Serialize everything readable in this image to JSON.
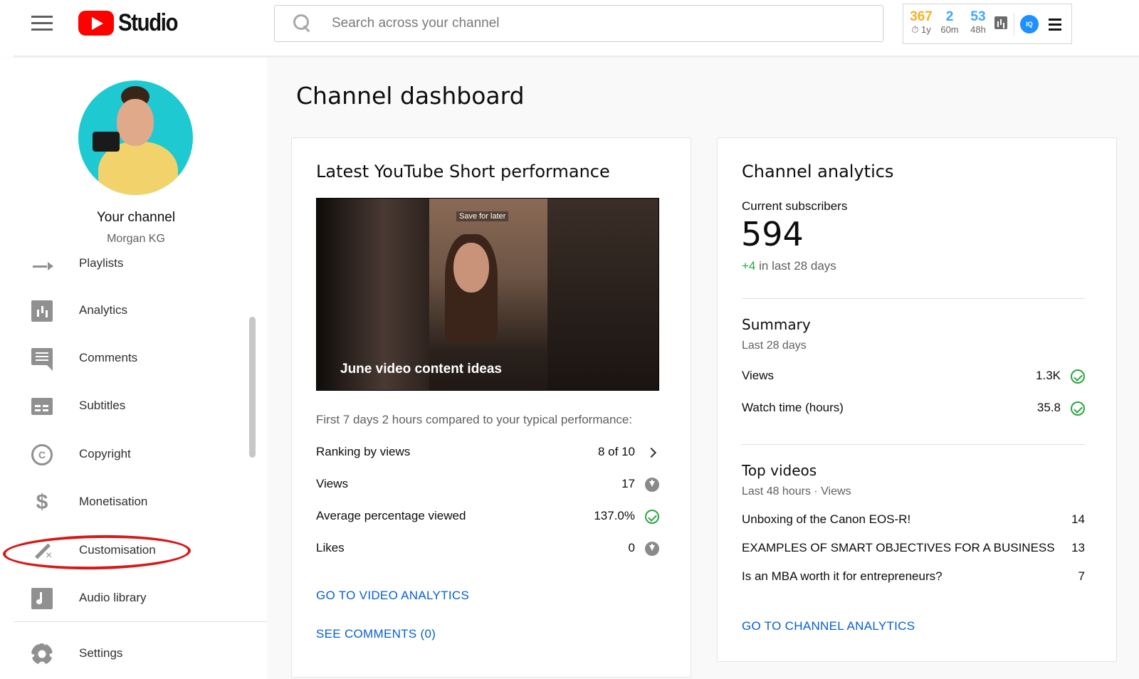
{
  "header": {
    "logo_text": "Studio",
    "search_placeholder": "Search across your channel",
    "extension": {
      "stats": [
        {
          "value": "367",
          "label": "⏱ 1y",
          "color": "#f0b429"
        },
        {
          "value": "2",
          "label": "60m",
          "color": "#3ea6ff"
        },
        {
          "value": "53",
          "label": "48h",
          "color": "#3ea6ff"
        }
      ],
      "badge": "IQ"
    }
  },
  "sidebar": {
    "channel_title": "Your channel",
    "channel_name": "Morgan KG",
    "items": [
      {
        "label": "Playlists",
        "icon": "playlists-icon"
      },
      {
        "label": "Analytics",
        "icon": "analytics-icon"
      },
      {
        "label": "Comments",
        "icon": "comments-icon"
      },
      {
        "label": "Subtitles",
        "icon": "subtitles-icon"
      },
      {
        "label": "Copyright",
        "icon": "copyright-icon"
      },
      {
        "label": "Monetisation",
        "icon": "monetisation-icon"
      },
      {
        "label": "Customisation",
        "icon": "customisation-wand-icon"
      },
      {
        "label": "Audio library",
        "icon": "audio-library-icon"
      },
      {
        "label": "Settings",
        "icon": "settings-gear-icon"
      }
    ]
  },
  "main": {
    "page_title": "Channel dashboard",
    "short_card": {
      "title": "Latest YouTube Short performance",
      "thumbnail_caption": "June video content ideas",
      "thumbnail_overlay": "Save for later",
      "comparison_text": "First 7 days 2 hours compared to your typical performance:",
      "metrics": [
        {
          "label": "Ranking by views",
          "value": "8 of 10",
          "indicator": "chevron-right-icon"
        },
        {
          "label": "Views",
          "value": "17",
          "indicator": "arrow-down-icon"
        },
        {
          "label": "Average percentage viewed",
          "value": "137.0%",
          "indicator": "check-circle-icon"
        },
        {
          "label": "Likes",
          "value": "0",
          "indicator": "arrow-down-icon"
        }
      ],
      "link_analytics": "GO TO VIDEO ANALYTICS",
      "link_comments": "SEE COMMENTS (0)"
    },
    "analytics_card": {
      "title": "Channel analytics",
      "subscribers_label": "Current subscribers",
      "subscribers_value": "594",
      "subscribers_delta": "+4",
      "subscribers_delta_suffix": " in last 28 days",
      "summary_title": "Summary",
      "summary_period": "Last 28 days",
      "summary_rows": [
        {
          "label": "Views",
          "value": "1.3K"
        },
        {
          "label": "Watch time (hours)",
          "value": "35.8"
        }
      ],
      "top_videos_title": "Top videos",
      "top_videos_period": "Last 48 hours · Views",
      "top_videos": [
        {
          "title": "Unboxing of the Canon EOS-R!",
          "views": "14"
        },
        {
          "title": "EXAMPLES OF SMART OBJECTIVES FOR A BUSINESS",
          "views": "13"
        },
        {
          "title": "Is an MBA worth it for entrepreneurs?",
          "views": "7"
        }
      ],
      "link": "GO TO CHANNEL ANALYTICS"
    }
  }
}
